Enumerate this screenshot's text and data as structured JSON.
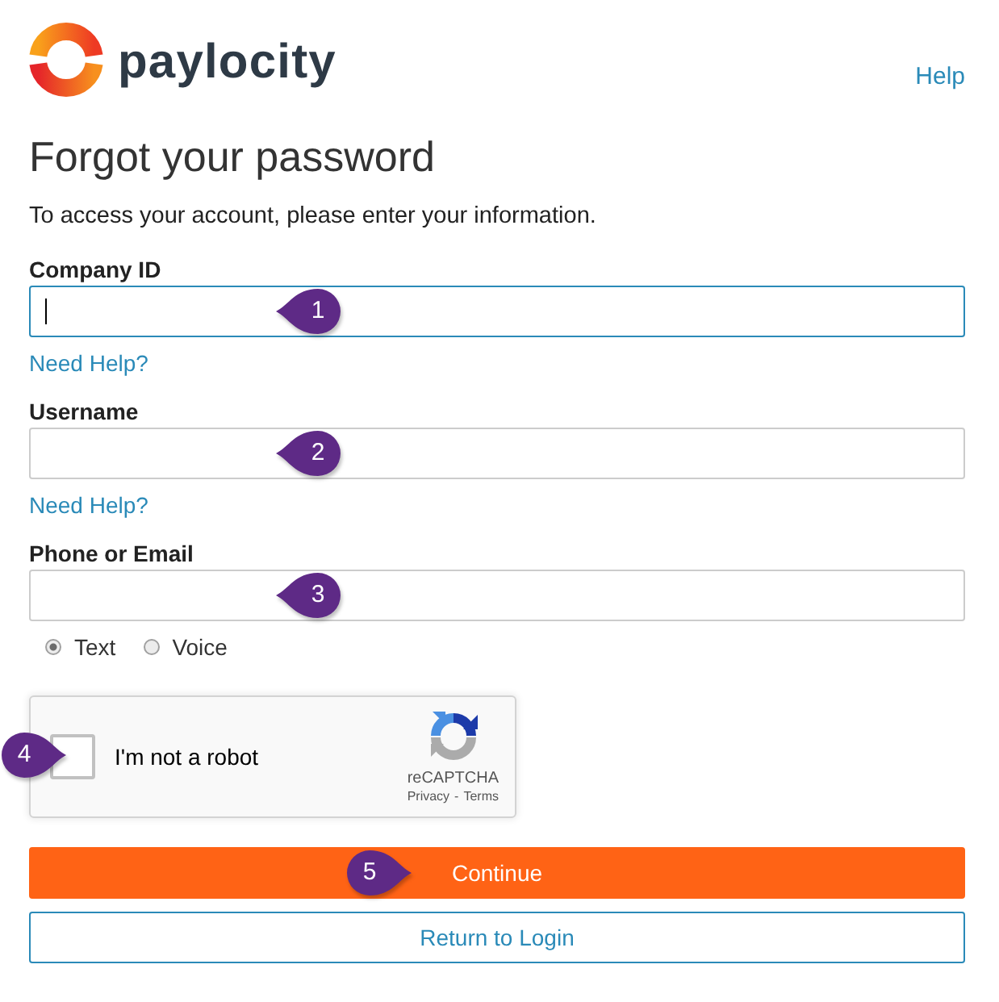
{
  "header": {
    "logo_text": "paylocity",
    "help_link": "Help"
  },
  "title": "Forgot your password",
  "intro": "To access your account, please enter your information.",
  "fields": [
    {
      "label": "Company ID",
      "focused": true,
      "help_link": "Need Help?",
      "callout": {
        "number": "1",
        "kind": "left"
      }
    },
    {
      "label": "Username",
      "focused": false,
      "help_link": "Need Help?",
      "callout": {
        "number": "2",
        "kind": "left"
      }
    },
    {
      "label": "Phone or Email",
      "focused": false,
      "callout": {
        "number": "3",
        "kind": "left"
      }
    }
  ],
  "delivery_options": [
    {
      "label": "Text",
      "selected": true
    },
    {
      "label": "Voice",
      "selected": false
    }
  ],
  "captcha": {
    "checked": false,
    "label": "I'm not a robot",
    "brand": "reCAPTCHA",
    "links": [
      "Privacy",
      "Terms"
    ],
    "separator": "-",
    "callout": {
      "number": "4",
      "kind": "right"
    }
  },
  "buttons": [
    {
      "label": "Continue",
      "kind": "primary",
      "callout": {
        "number": "5",
        "kind": "right"
      }
    },
    {
      "label": "Return to Login",
      "kind": "secondary"
    }
  ]
}
